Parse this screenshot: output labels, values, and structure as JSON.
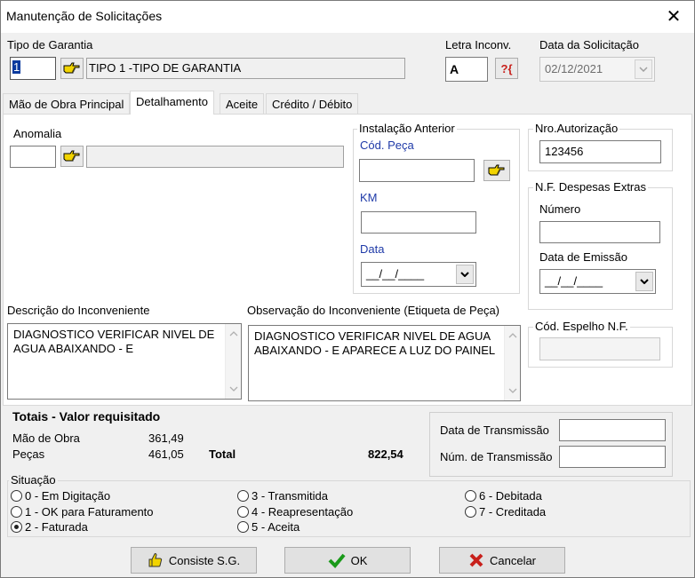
{
  "window": {
    "title": "Manutenção de Solicitações",
    "close_glyph": "✕"
  },
  "header": {
    "tipo_garantia_label": "Tipo de Garantia",
    "tipo_garantia_code": "1",
    "tipo_garantia_desc": "TIPO 1 -TIPO DE  GARANTIA",
    "letra_inconv_label": "Letra Inconv.",
    "letra_inconv_value": "A",
    "help_button_glyph": "?{",
    "data_solicitacao_label": "Data da Solicitação",
    "data_solicitacao_value": "02/12/2021"
  },
  "tabs": [
    {
      "label": "Mão de Obra Principal",
      "active": false
    },
    {
      "label": "Detalhamento",
      "active": true
    },
    {
      "label": "Aceite",
      "active": false
    },
    {
      "label": "Crédito / Débito",
      "active": false
    }
  ],
  "detalhamento": {
    "anomalia_label": "Anomalia",
    "anomalia_code": "",
    "anomalia_desc": "",
    "instalacao_anterior": {
      "title": "Instalação Anterior",
      "cod_peca_label": "Cód. Peça",
      "cod_peca_value": "",
      "km_label": "KM",
      "km_value": "",
      "data_label": "Data",
      "data_value": "__/__/____"
    },
    "nro_autorizacao": {
      "title": "Nro.Autorização",
      "value": "123456"
    },
    "nf_despesas": {
      "title": "N.F. Despesas Extras",
      "numero_label": "Número",
      "numero_value": "",
      "data_emissao_label": "Data de Emissão",
      "data_emissao_value": "__/__/____"
    },
    "cod_espelho": {
      "title": "Cód. Espelho N.F.",
      "value": ""
    },
    "descricao_label": "Descrição do Inconveniente",
    "descricao_value": "DIAGNOSTICO VERIFICAR NIVEL DE AGUA ABAIXANDO - E",
    "observacao_label": "Observação do Inconveniente (Etiqueta de Peça)",
    "observacao_value": "DIAGNOSTICO VERIFICAR NIVEL DE AGUA ABAIXANDO - E APARECE A LUZ DO PAINEL"
  },
  "totais": {
    "title": "Totais - Valor requisitado",
    "mao_obra_label": "Mão de Obra",
    "mao_obra_value": "361,49",
    "pecas_label": "Peças",
    "pecas_value": "461,05",
    "total_label": "Total",
    "total_value": "822,54"
  },
  "transmissao": {
    "data_label": "Data de Transmissão",
    "data_value": "",
    "num_label": "Núm. de Transmissão",
    "num_value": ""
  },
  "situacao": {
    "label": "Situação",
    "options": [
      {
        "label": "0 - Em Digitação",
        "selected": false
      },
      {
        "label": "1 - OK para Faturamento",
        "selected": false
      },
      {
        "label": "2 - Faturada",
        "selected": true
      },
      {
        "label": "3 - Transmitida",
        "selected": false
      },
      {
        "label": "4 - Reapresentação",
        "selected": false
      },
      {
        "label": "5 - Aceita",
        "selected": false
      },
      {
        "label": "6 - Debitada",
        "selected": false
      },
      {
        "label": "7 - Creditada",
        "selected": false
      }
    ]
  },
  "buttons": {
    "consiste_label": "Consiste S.G.",
    "ok_label": "OK",
    "cancelar_label": "Cancelar"
  },
  "icons": {
    "lookup": "pointing-hand-icon",
    "consiste": "thumbs-up-icon",
    "ok": "check-icon",
    "cancel": "x-icon",
    "dropdown": "chevron-down-icon"
  },
  "colors": {
    "field_label_blue": "#1f3aa8",
    "ok_green": "#1a9a1a",
    "cancel_red": "#c8201b",
    "lookup_yellow": "#f2d400"
  }
}
